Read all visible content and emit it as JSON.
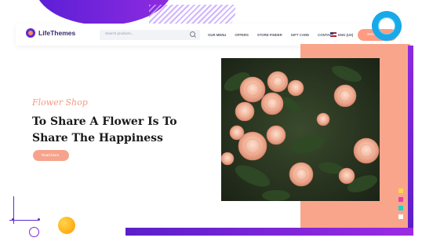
{
  "header": {
    "logo_text": "LifeThemes",
    "search_placeholder": "Search products...",
    "nav_items": [
      "OUR MENU",
      "OFFERS",
      "STORE FINDER",
      "GIFT CARD",
      "CONTACT"
    ],
    "currency": "ENG (US)",
    "button_label": "SHOP"
  },
  "hero": {
    "eyebrow": "Flower Shop",
    "headline": "To Share A Flower Is To Share The Happiness",
    "cta_label": "Read More"
  },
  "colors": {
    "purple": "#5b1fd6",
    "peach": "#f9a58c",
    "accent_blue": "#19a9e8",
    "dot_colors": [
      "#ffd54a",
      "#e63fa6",
      "#22d3c5",
      "#ffffff"
    ]
  },
  "icons": [
    "logo-icon",
    "search-icon",
    "us-flag-icon",
    "ring-icon"
  ]
}
